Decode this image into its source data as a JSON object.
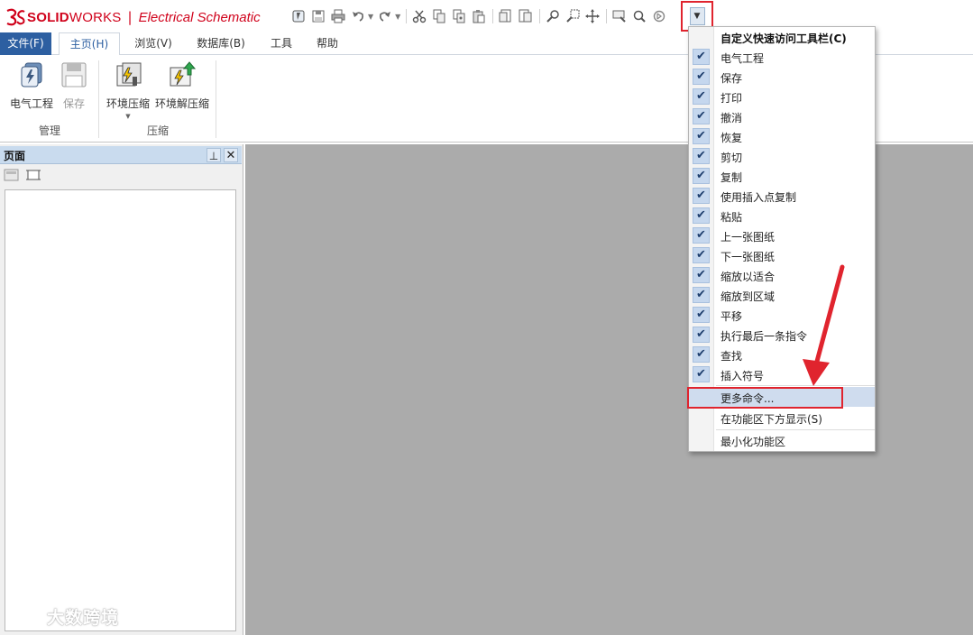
{
  "app": {
    "brand": "SOLID",
    "brand_suffix": "WORKS",
    "separator": "|",
    "product": "Electrical Schematic"
  },
  "qat": {
    "icons": [
      "project-icon",
      "save-icon",
      "print-icon",
      "undo-icon",
      "redo-icon",
      "cut-icon",
      "copy-icon",
      "copy-with-point-icon",
      "paste-icon",
      "previous-sheet-icon",
      "next-sheet-icon",
      "zoom-fit-icon",
      "zoom-window-icon",
      "pan-icon",
      "repeat-command-icon",
      "find-icon",
      "insert-symbol-icon",
      "customize-dropdown-icon"
    ]
  },
  "tabs": {
    "file": "文件(F)",
    "home": "主页(H)",
    "browse": "浏览(V)",
    "database": "数据库(B)",
    "tools": "工具",
    "help": "帮助"
  },
  "ribbon": {
    "project": "电气工程",
    "save": "保存",
    "compress": "环境压缩",
    "decompress": "环境解压缩",
    "group_manage": "管理",
    "group_compress": "压缩"
  },
  "left_pane": {
    "title": "页面",
    "pin": "📌",
    "close": "✕"
  },
  "menu": {
    "title": "自定义快速访问工具栏(C)",
    "checked_items": [
      "电气工程",
      "保存",
      "打印",
      "撤消",
      "恢复",
      "剪切",
      "复制",
      "使用插入点复制",
      "粘贴",
      "上一张图纸",
      "下一张图纸",
      "缩放以适合",
      "缩放到区域",
      "平移",
      "执行最后一条指令",
      "查找",
      "插入符号"
    ],
    "more_commands": "更多命令...",
    "show_below": "在功能区下方显示(S)",
    "minimize": "最小化功能区",
    "check_mark": "✔"
  },
  "colors": {
    "brand_red": "#d0021b",
    "file_tab_blue": "#2d5fa1",
    "workspace_gray": "#ababab",
    "highlight_red": "#e0242e"
  },
  "watermark": {
    "text": "大数跨境"
  }
}
